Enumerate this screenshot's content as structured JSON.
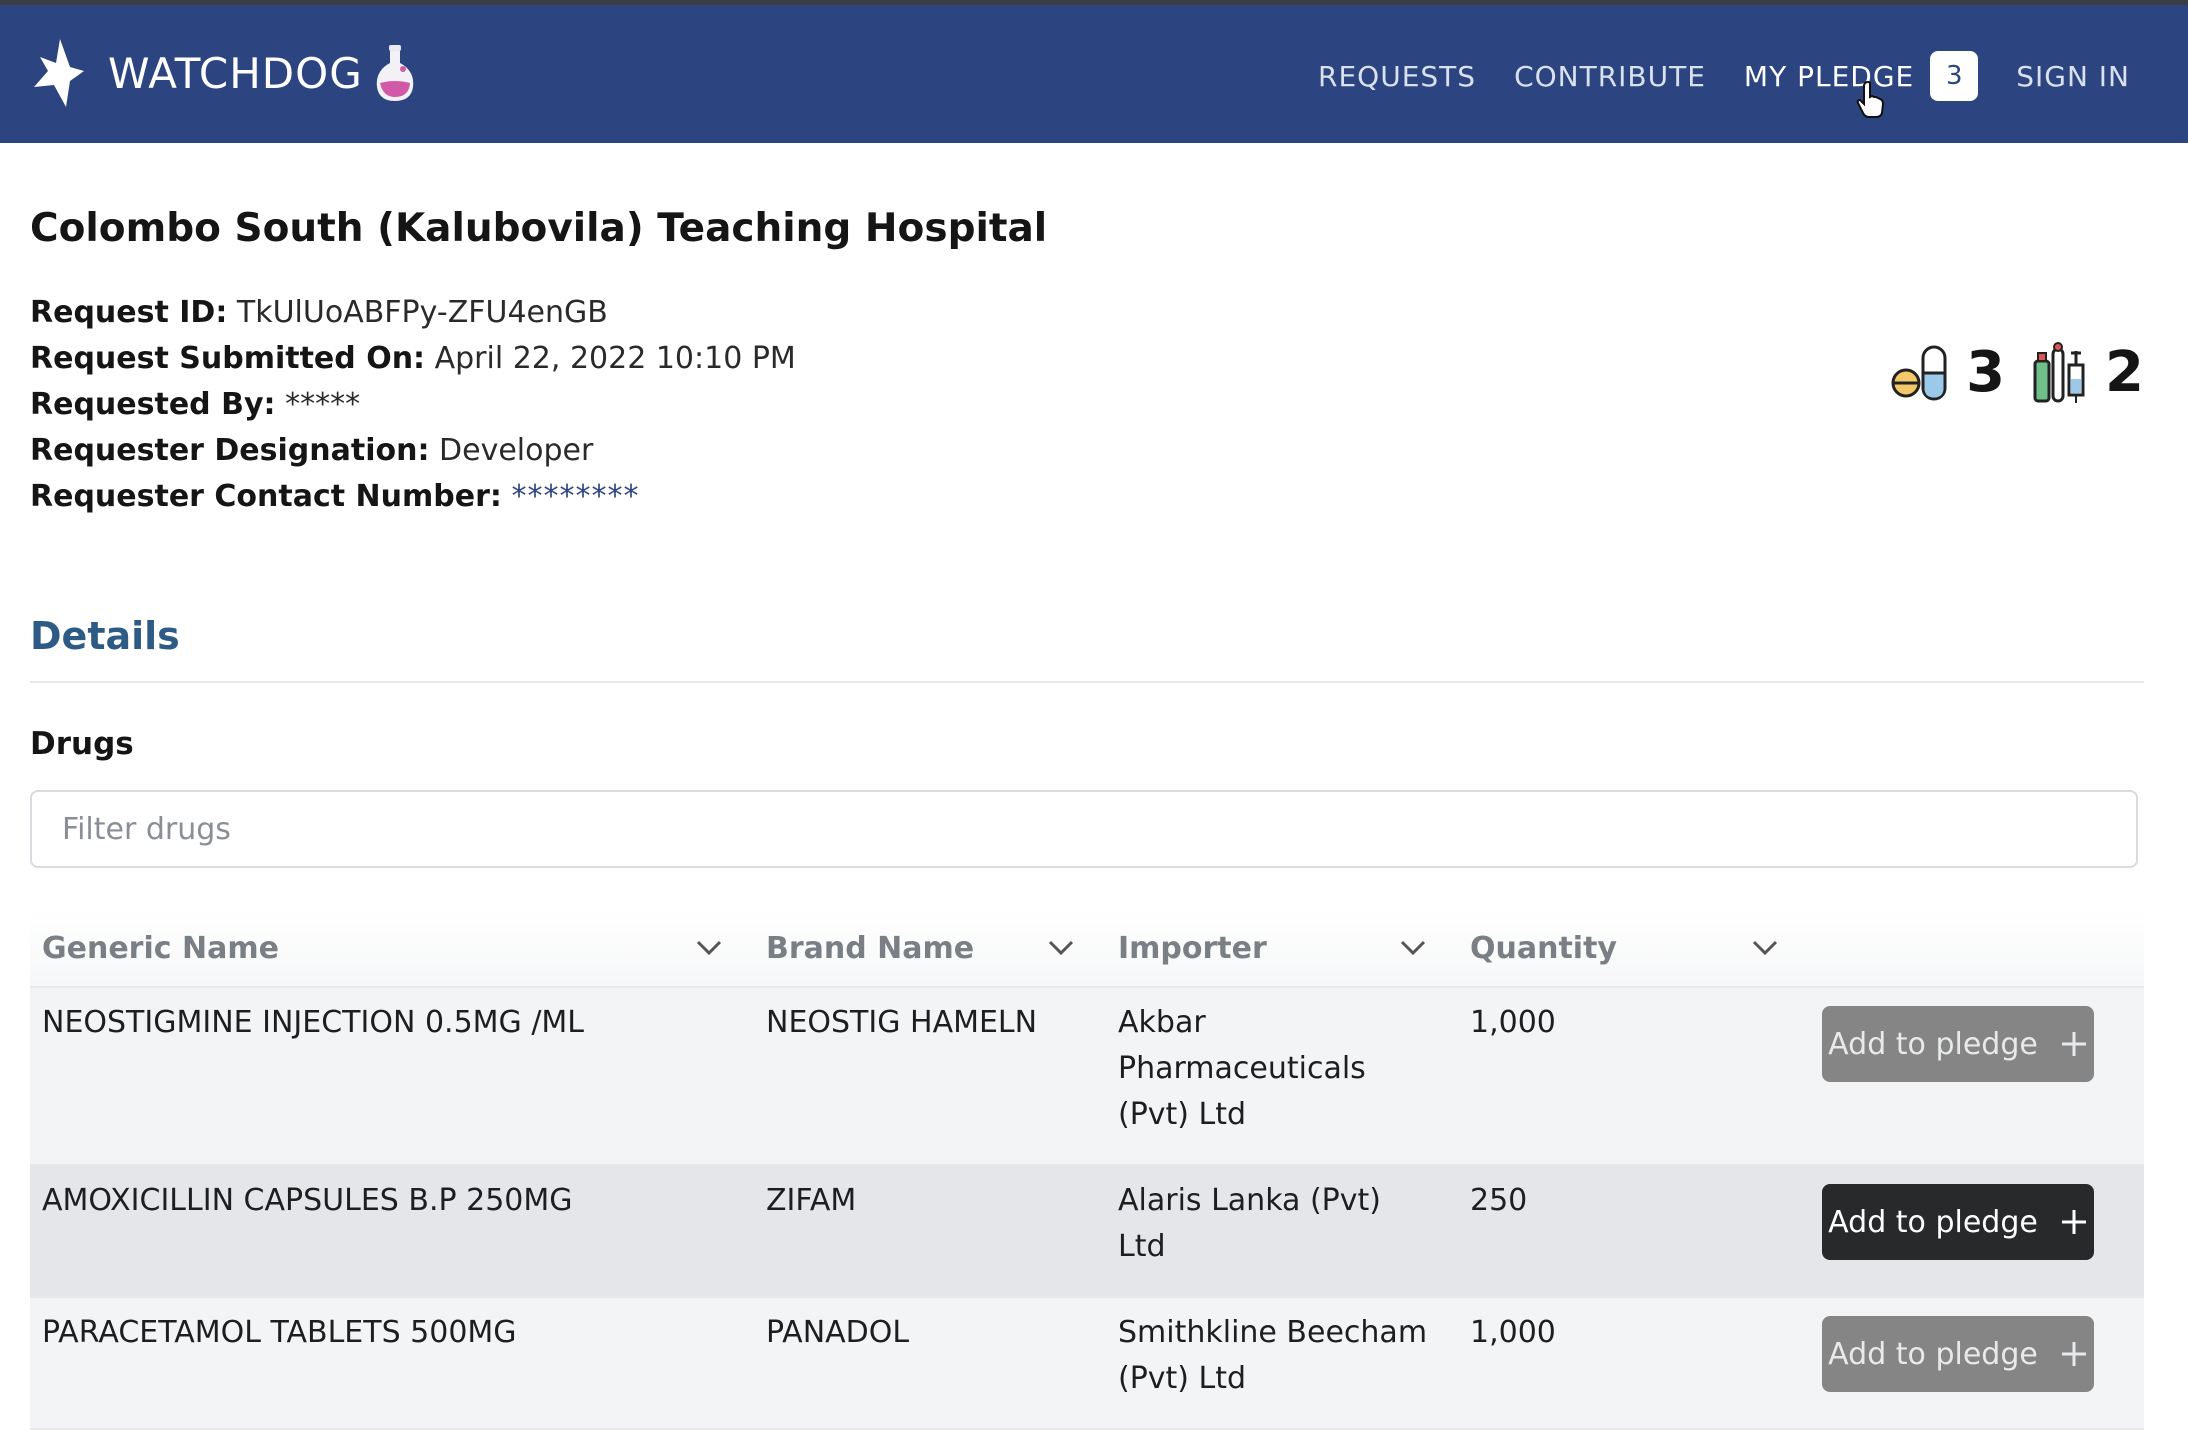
{
  "app": {
    "brand": "WATCHDOG"
  },
  "nav": {
    "requests": "REQUESTS",
    "contribute": "CONTRIBUTE",
    "my_pledge": "MY PLEDGE",
    "pledge_count": "3",
    "sign_in": "SIGN IN"
  },
  "hospital": {
    "name": "Colombo South (Kalubovila) Teaching Hospital"
  },
  "request": {
    "id_label": "Request ID:",
    "id_value": "TkUlUoABFPy-ZFU4enGB",
    "submitted_label": "Request Submitted On:",
    "submitted_value": "April 22, 2022 10:10 PM",
    "by_label": "Requested By:",
    "by_value": "*****",
    "designation_label": "Requester Designation:",
    "designation_value": "Developer",
    "contact_label": "Requester Contact Number:",
    "contact_value": "********"
  },
  "summary": {
    "drugs_icon": "pills-icon",
    "drugs_count": "3",
    "devices_icon": "medical-supplies-icon",
    "devices_count": "2"
  },
  "details": {
    "heading": "Details",
    "drugs_heading": "Drugs",
    "filter_placeholder": "Filter drugs"
  },
  "table": {
    "headers": [
      "Generic Name",
      "Brand Name",
      "Importer",
      "Quantity"
    ],
    "rows": [
      {
        "generic": "NEOSTIGMINE INJECTION 0.5MG /ML",
        "brand": "NEOSTIG HAMELN",
        "importer": "Akbar Pharmaceuticals (Pvt) Ltd",
        "quantity": "1,000",
        "action": "Add to pledge"
      },
      {
        "generic": "AMOXICILLIN CAPSULES B.P 250MG",
        "brand": "ZIFAM",
        "importer": "Alaris Lanka (Pvt) Ltd",
        "quantity": "250",
        "action": "Add to pledge"
      },
      {
        "generic": "PARACETAMOL TABLETS 500MG",
        "brand": "PANADOL",
        "importer": "Smithkline Beecham (Pvt) Ltd",
        "quantity": "1,000",
        "action": "Add to pledge"
      }
    ]
  },
  "colors": {
    "navbar": "#2c4580",
    "details_heading": "#2e5b85",
    "button_active": "#27292b",
    "button_default": "#858585"
  }
}
